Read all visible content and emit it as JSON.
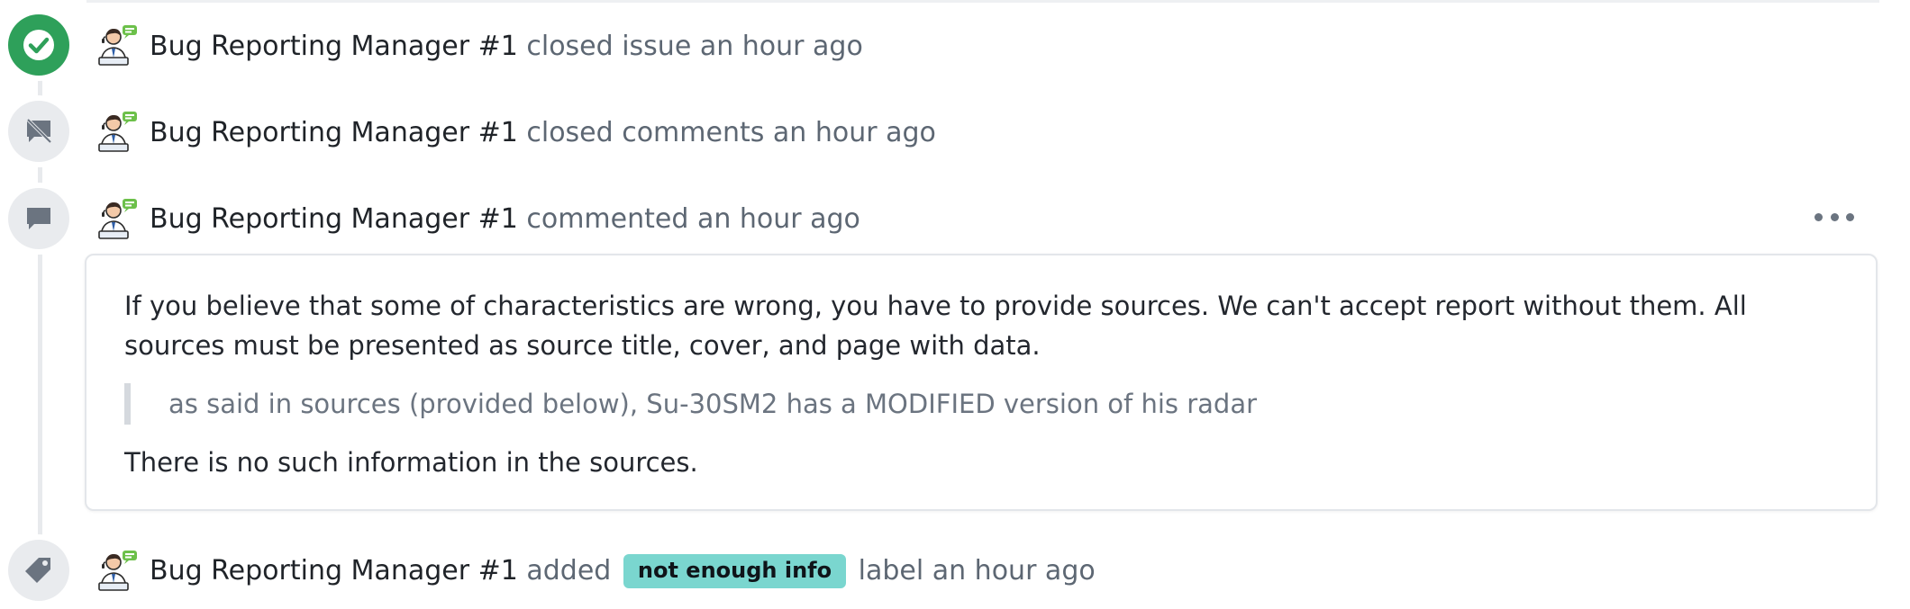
{
  "colors": {
    "success_badge": "#2ea05a",
    "neutral_badge": "#e9ebee",
    "label_chip": "#7ad6cf",
    "muted_text": "#5d6773"
  },
  "events": [
    {
      "type": "closed-issue",
      "icon": "check-circle-icon",
      "author": "Bug Reporting Manager #1",
      "action": "closed issue",
      "time": "an hour ago"
    },
    {
      "type": "closed-comments",
      "icon": "comment-off-icon",
      "author": "Bug Reporting Manager #1",
      "action": "closed comments",
      "time": "an hour ago"
    },
    {
      "type": "comment",
      "icon": "comment-icon",
      "author": "Bug Reporting Manager #1",
      "action": "commented",
      "time": "an hour ago",
      "more_icon": "more-horizontal-icon",
      "body": {
        "paragraph": "If you believe that some of characteristics are wrong, you have to provide sources. We can't accept report without them. All sources must be presented as source title, cover, and page with data.",
        "quote": "as said in sources (provided below), Su-30SM2 has a MODIFIED version of his radar",
        "closing": "There is no such information in the sources."
      }
    },
    {
      "type": "labeled",
      "icon": "tag-icon",
      "author": "Bug Reporting Manager #1",
      "action": "added",
      "label": "not enough info",
      "suffix": "label",
      "time": "an hour ago"
    }
  ]
}
